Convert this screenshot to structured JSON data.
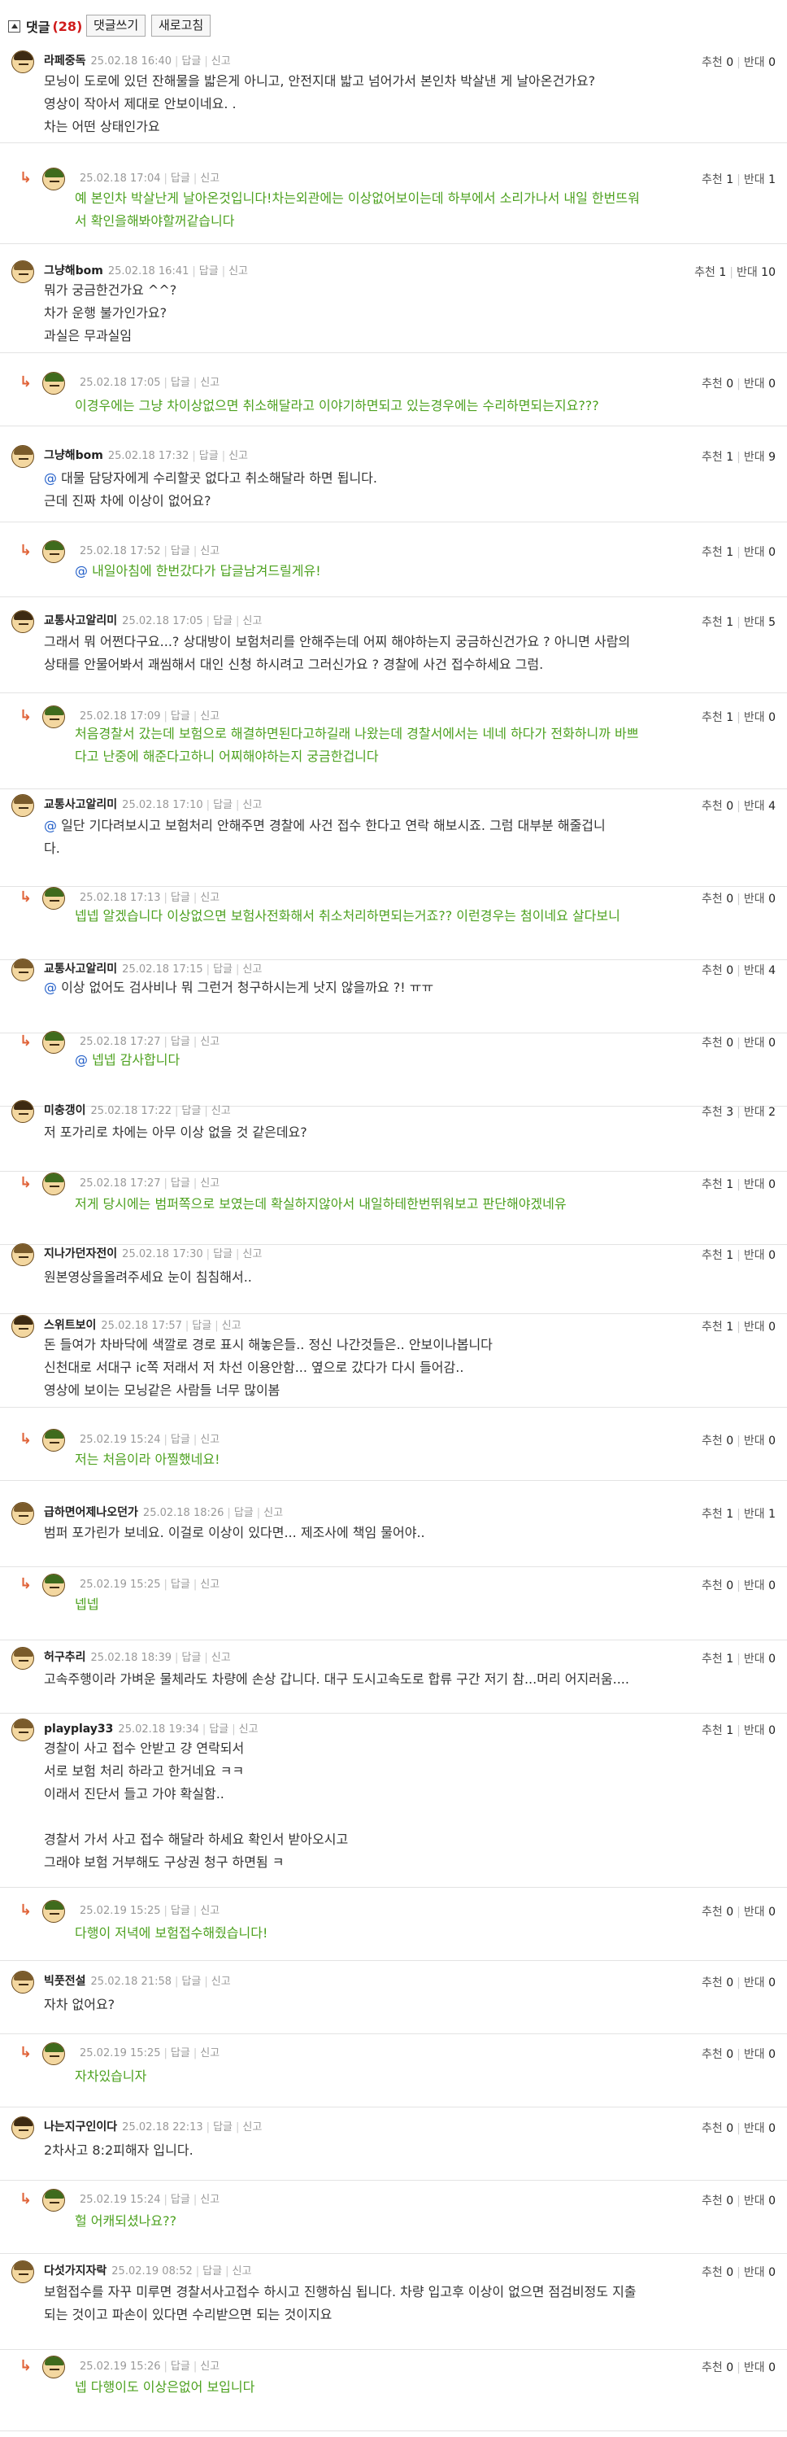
{
  "toolbar": {
    "title": "댓글",
    "count": "(28)",
    "write": "댓글쓰기",
    "refresh": "새로고침"
  },
  "labels": {
    "reply": "답글",
    "report": "신고",
    "up": "추천",
    "down": "반대",
    "arrow": "↳",
    "at": "@"
  },
  "comments": [
    {
      "nick": "라페중독",
      "date": "25.02.18 16:40",
      "up": "0",
      "down": "0",
      "text": "모닝이 도로에 있던 잔해물을 밟은게 아니고, 안전지대 밟고 넘어가서 본인차 박살낸 게 날아온건가요?\n영상이 작아서 제대로 안보이네요. .\n차는 어떤 상태인가요"
    },
    {
      "nick": "",
      "date": "25.02.18 17:04",
      "up": "1",
      "down": "1",
      "text": "예 본인차 박살난게 날아온것입니다!차는외관에는 이상없어보이는데 하부에서 소리가나서 내일 한번뜨워\n서 확인을해봐야할꺼같습니다"
    },
    {
      "nick": "그냥해bom",
      "date": "25.02.18 16:41",
      "up": "1",
      "down": "10",
      "text": "뭐가 궁금한건가요 ^^?\n차가 운행 불가인가요?\n과실은 무과실임"
    },
    {
      "nick": "",
      "date": "25.02.18 17:05",
      "up": "0",
      "down": "0",
      "text": "이경우에는 그냥 차이상없으면 취소해달라고 이야기하면되고 있는경우에는 수리하면되는지요???"
    },
    {
      "nick": "그냥해bom",
      "date": "25.02.18 17:32",
      "up": "1",
      "down": "9",
      "mention": "@",
      "text": " 대물 담당자에게 수리할곳 없다고 취소해달라 하면 됩니다.\n근데 진짜 차에 이상이 없어요?"
    },
    {
      "nick": "",
      "date": "25.02.18 17:52",
      "up": "1",
      "down": "0",
      "mention": "@",
      "text": " 내일아침에 한번갔다가 답글남겨드릴게유!"
    },
    {
      "nick": "교통사고알리미",
      "date": "25.02.18 17:05",
      "up": "1",
      "down": "5",
      "text": "그래서 뭐 어쩐다구요...? 상대방이 보험처리를 안해주는데 어찌 해야하는지 궁금하신건가요 ? 아니면 사람의\n상태를 안물어봐서 괘씸해서 대인 신청 하시려고 그러신가요 ? 경찰에 사건 접수하세요 그럼."
    },
    {
      "nick": "",
      "date": "25.02.18 17:09",
      "up": "1",
      "down": "0",
      "text": "처음경찰서 갔는데 보험으로 해결하면된다고하길래 나왔는데 경찰서에서는 네네 하다가 전화하니까 바쁘\n다고 난중에 해준다고하니 어찌해야하는지 궁금한겁니다"
    },
    {
      "nick": "교통사고알리미",
      "date": "25.02.18 17:10",
      "up": "0",
      "down": "4",
      "mention": "@",
      "text": " 일단 기다려보시고 보험처리 안해주면 경찰에 사건 접수 한다고 연락 해보시죠. 그럼 대부분 해줄겁니\n다."
    },
    {
      "nick": "",
      "date": "25.02.18 17:13",
      "up": "0",
      "down": "0",
      "text": "넵넵 알겠습니다 이상없으면 보험사전화해서 취소처리하면되는거죠?? 이런경우는 첨이네요 살다보니"
    },
    {
      "nick": "교통사고알리미",
      "date": "25.02.18 17:15",
      "up": "0",
      "down": "4",
      "mention": "@",
      "text": " 이상 없어도 검사비나 뭐 그런거 청구하시는게 낫지 않을까요 ?! ㅠㅠ"
    },
    {
      "nick": "",
      "date": "25.02.18 17:27",
      "up": "0",
      "down": "0",
      "mention": "@",
      "text": " 넵넵 감사합니다"
    },
    {
      "nick": "미충갱이",
      "date": "25.02.18 17:22",
      "up": "3",
      "down": "2",
      "text": "저 포가리로 차에는 아무 이상 없을 것 같은데요?"
    },
    {
      "nick": "",
      "date": "25.02.18 17:27",
      "up": "1",
      "down": "0",
      "text": "저게 당시에는 범퍼쪽으로 보였는데 확실하지않아서 내일하테한번뛰워보고 판단해야겠네유"
    },
    {
      "nick": "지나가던자전이",
      "date": "25.02.18 17:30",
      "up": "1",
      "down": "0",
      "text": "원본영상을올려주세요 눈이 침침해서.."
    },
    {
      "nick": "스위트보이",
      "date": "25.02.18 17:57",
      "up": "1",
      "down": "0",
      "text": "돈 들여가 차바닥에 색깔로 경로 표시 해놓은들.. 정신 나간것들은.. 안보이나봅니다\n신천대로 서대구 ic쪽 저래서 저 차선 이용안함... 옆으로 갔다가 다시 들어감..\n영상에 보이는 모닝같은 사람들 너무 많이봄"
    },
    {
      "nick": "",
      "date": "25.02.19 15:24",
      "up": "0",
      "down": "0",
      "text": "저는 처음이라 아찔했네요!"
    },
    {
      "nick": "급하면어제나오던가",
      "date": "25.02.18 18:26",
      "up": "1",
      "down": "1",
      "text": "범퍼 포가린가 보네요. 이걸로 이상이 있다면... 제조사에 책임 물어야.."
    },
    {
      "nick": "",
      "date": "25.02.19 15:25",
      "up": "0",
      "down": "0",
      "text": "넵넵"
    },
    {
      "nick": "허구추리",
      "date": "25.02.18 18:39",
      "up": "1",
      "down": "0",
      "text": "고속주행이라 가벼운 물체라도 차량에 손상 갑니다. 대구 도시고속도로 합류 구간 저기 참...머리 어지러움...."
    },
    {
      "nick": "playplay33",
      "date": "25.02.18 19:34",
      "up": "1",
      "down": "0",
      "text": "경찰이 사고 접수 안받고 걍 연락되서\n서로 보험 처리 하라고 한거네요 ㅋㅋ\n이래서 진단서 들고 가야 확실함..\n\n경찰서 가서 사고 접수 해달라 하세요 확인서 받아오시고\n그래야 보험 거부해도 구상권 청구 하면됨 ㅋ"
    },
    {
      "nick": "",
      "date": "25.02.19 15:25",
      "up": "0",
      "down": "0",
      "text": "다행이 저녁에 보험접수해줬습니다!"
    },
    {
      "nick": "빅풋전설",
      "date": "25.02.18 21:58",
      "up": "0",
      "down": "0",
      "text": "자차 없어요?"
    },
    {
      "nick": "",
      "date": "25.02.19 15:25",
      "up": "0",
      "down": "0",
      "text": "자차있습니자"
    },
    {
      "nick": "나는지구인이다",
      "date": "25.02.18 22:13",
      "up": "0",
      "down": "0",
      "text": "2차사고 8:2피해자 입니다."
    },
    {
      "nick": "",
      "date": "25.02.19 15:24",
      "up": "0",
      "down": "0",
      "text": "헐 어캐되셨나요??"
    },
    {
      "nick": "다섯가지자락",
      "date": "25.02.19 08:52",
      "up": "0",
      "down": "0",
      "text": "보험접수를 자꾸 미루면 경찰서사고접수 하시고 진행하심 됩니다. 차량 입고후 이상이 없으면 점검비정도 지출\n되는 것이고 파손이 있다면 수리받으면 되는 것이지요"
    },
    {
      "nick": "",
      "date": "25.02.19 15:26",
      "up": "0",
      "down": "0",
      "text": "넵 다행이도 이상은없어 보입니다"
    }
  ]
}
